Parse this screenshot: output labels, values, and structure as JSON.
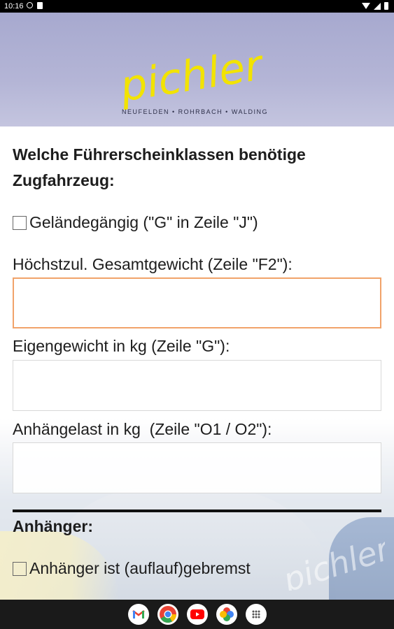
{
  "status_bar": {
    "time": "10:16"
  },
  "header": {
    "logo_text": "pichler",
    "logo_subtitle": "NEUFELDEN • ROHRBACH • WALDING",
    "logo_color": "#f2e300"
  },
  "form": {
    "question_title": "Welche Führerscheinklassen benötige Zugfahrzeug:",
    "checkbox_offroad_label": "Geländegängig (\"G\" in Zeile \"J\")",
    "label_total_weight": "Höchstzul. Gesamtgewicht (Zeile \"F2\"):",
    "label_curb_weight": "Eigengewicht in kg (Zeile \"G\"):",
    "label_towing_capacity": "Anhängelast in kg  (Zeile \"O1 / O2\"):",
    "section_trailer_title": "Anhänger:",
    "checkbox_trailer_braked_label": "Anhänger ist (auflauf)gebremst",
    "focus_color": "#f1a36a"
  },
  "dock": {
    "apps": [
      "gmail-icon",
      "chrome-icon",
      "youtube-icon",
      "photos-icon",
      "app-drawer-icon"
    ]
  }
}
